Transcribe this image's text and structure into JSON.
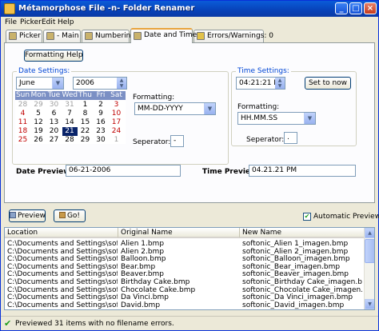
{
  "window": {
    "title": "Métamorphose File -n- Folder Renamer"
  },
  "menu": [
    "File",
    "Picker",
    "Edit",
    "Help"
  ],
  "tabs": [
    {
      "label": "Picker",
      "icon": "picker-icon"
    },
    {
      "label": "- Main -",
      "icon": "main-icon"
    },
    {
      "label": "Numbering",
      "icon": "numbering-icon"
    },
    {
      "label": "Date and Time",
      "icon": "calendar-icon",
      "active": true
    },
    {
      "label": "Errors/Warnings: 0",
      "icon": "warning-icon"
    }
  ],
  "date_time": {
    "formatting_help": "Formatting Help",
    "date_settings": {
      "label": "Date Settings:",
      "month": "June",
      "year": "2006",
      "formatting_label": "Formatting:",
      "formatting_value": "MM-DD-YYYY",
      "separator_label": "Seperator:",
      "separator_value": "-"
    },
    "time_settings": {
      "label": "Time Settings:",
      "time": "04:21:21 PM",
      "set_to_now": "Set to now",
      "formatting_label": "Formatting:",
      "formatting_value": "HH.MM.SS",
      "separator_label": "Seperator:",
      "separator_value": "."
    },
    "calendar": {
      "weekdays": [
        "Sun",
        "Mon",
        "Tue",
        "Wed",
        "Thu",
        "Fri",
        "Sat"
      ],
      "weeks": [
        [
          "28",
          "29",
          "30",
          "31",
          "1",
          "2",
          "3"
        ],
        [
          "4",
          "5",
          "6",
          "7",
          "8",
          "9",
          "10"
        ],
        [
          "11",
          "12",
          "13",
          "14",
          "15",
          "16",
          "17"
        ],
        [
          "18",
          "19",
          "20",
          "21",
          "22",
          "23",
          "24"
        ],
        [
          "25",
          "26",
          "27",
          "28",
          "29",
          "30",
          "1"
        ]
      ],
      "selected": "21"
    },
    "date_preview_label": "Date Preview:",
    "date_preview_value": "06-21-2006",
    "time_preview_label": "Time Preview:",
    "time_preview_value": "04.21.21 PM"
  },
  "actions": {
    "preview": "Preview",
    "go": "Go!",
    "automatic_preview": "Automatic Preview",
    "automatic_preview_checked": true
  },
  "list": {
    "columns": [
      "Location",
      "Original Name",
      "New Name"
    ],
    "rows": [
      [
        "C:\\Documents and Settings\\softo...",
        "Alien 1.bmp",
        "softonic_Alien 1_imagen.bmp"
      ],
      [
        "C:\\Documents and Settings\\softo...",
        "Alien 2.bmp",
        "softonic_Alien 2_imagen.bmp"
      ],
      [
        "C:\\Documents and Settings\\softo...",
        "Balloon.bmp",
        "softonic_Balloon_imagen.bmp"
      ],
      [
        "C:\\Documents and Settings\\softo...",
        "Bear.bmp",
        "softonic_Bear_imagen.bmp"
      ],
      [
        "C:\\Documents and Settings\\softo...",
        "Beaver.bmp",
        "softonic_Beaver_imagen.bmp"
      ],
      [
        "C:\\Documents and Settings\\softo...",
        "Birthday Cake.bmp",
        "softonic_Birthday Cake_imagen.bmp"
      ],
      [
        "C:\\Documents and Settings\\softo...",
        "Chocolate Cake.bmp",
        "softonic_Chocolate Cake_imagen.bmp"
      ],
      [
        "C:\\Documents and Settings\\softo...",
        "Da Vinci.bmp",
        "softonic_Da Vinci_imagen.bmp"
      ],
      [
        "C:\\Documents and Settings\\softo...",
        "David.bmp",
        "softonic_David_imagen.bmp"
      ]
    ]
  },
  "status": {
    "text": "Previewed 31 items with no filename errors."
  }
}
